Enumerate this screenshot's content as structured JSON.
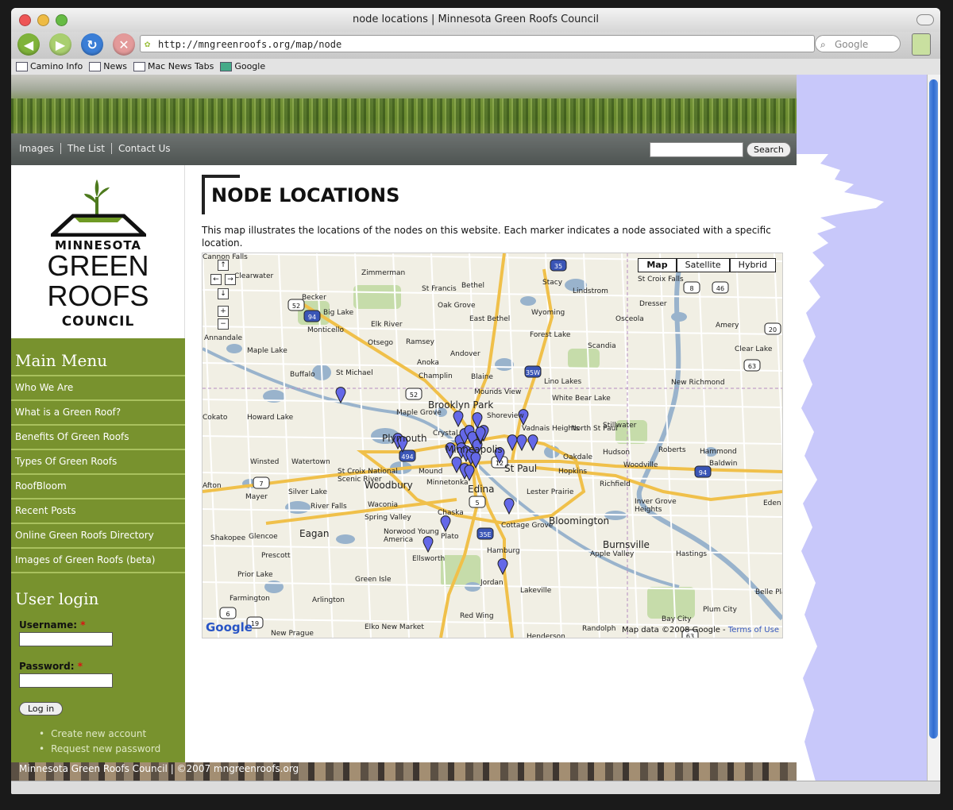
{
  "window": {
    "title": "node locations | Minnesota Green Roofs Council",
    "url": "http://mngreenroofs.org/map/node",
    "search_placeholder": "Google"
  },
  "bookmarks": [
    "Camino Info",
    "News",
    "Mac News Tabs",
    "Google"
  ],
  "site_nav": {
    "links": [
      "Images",
      "The List",
      "Contact Us"
    ],
    "search_button": "Search"
  },
  "logo": {
    "line1": "MINNESOTA",
    "line2": "GREEN",
    "line3": "ROOFS",
    "line4": "COUNCIL"
  },
  "main_menu": {
    "title": "Main Menu",
    "items": [
      "Who We Are",
      "What is a Green Roof?",
      "Benefits Of Green Roofs",
      "Types Of Green Roofs",
      "RoofBloom",
      "Recent Posts",
      "Online Green Roofs Directory",
      "Images of Green Roofs (beta)"
    ]
  },
  "user_login": {
    "title": "User login",
    "username_label": "Username:",
    "password_label": "Password:",
    "required_mark": "*",
    "login_button": "Log in",
    "links": [
      "Create new account",
      "Request new password"
    ]
  },
  "page": {
    "title": "NODE LOCATIONS",
    "intro": "This map illustrates the locations of the nodes on this website. Each marker indicates a node associated with a specific location."
  },
  "map": {
    "types": [
      "Map",
      "Satellite",
      "Hybrid"
    ],
    "active_type": "Map",
    "logo": "Google",
    "copyright": "Map data ©2008 Google -",
    "terms": "Terms of Use",
    "places": [
      {
        "name": "Zimmerman",
        "size": "s"
      },
      {
        "name": "St Francis",
        "size": "s"
      },
      {
        "name": "Bethel",
        "size": "s"
      },
      {
        "name": "Stacy",
        "size": "s"
      },
      {
        "name": "Lindstrom",
        "size": "s"
      },
      {
        "name": "St Croix Falls",
        "size": "s"
      },
      {
        "name": "Becker",
        "size": "s"
      },
      {
        "name": "Big Lake",
        "size": "s"
      },
      {
        "name": "Oak Grove",
        "size": "s"
      },
      {
        "name": "Wyoming",
        "size": "s"
      },
      {
        "name": "Dresser",
        "size": "s"
      },
      {
        "name": "Clearwater",
        "size": "s"
      },
      {
        "name": "East Bethel",
        "size": "s"
      },
      {
        "name": "Osceola",
        "size": "s"
      },
      {
        "name": "Monticello",
        "size": "s"
      },
      {
        "name": "Elk River",
        "size": "s"
      },
      {
        "name": "Amery",
        "size": "s"
      },
      {
        "name": "Annandale",
        "size": "s"
      },
      {
        "name": "Otsego",
        "size": "s"
      },
      {
        "name": "Ramsey",
        "size": "s"
      },
      {
        "name": "Forest Lake",
        "size": "s"
      },
      {
        "name": "Maple Lake",
        "size": "s"
      },
      {
        "name": "Andover",
        "size": "s"
      },
      {
        "name": "Scandia",
        "size": "s"
      },
      {
        "name": "Clear Lake",
        "size": "s"
      },
      {
        "name": "Anoka",
        "size": "s"
      },
      {
        "name": "Buffalo",
        "size": "s"
      },
      {
        "name": "St Michael",
        "size": "s"
      },
      {
        "name": "Champlin",
        "size": "s"
      },
      {
        "name": "Blaine",
        "size": "s"
      },
      {
        "name": "Lino Lakes",
        "size": "s"
      },
      {
        "name": "New Richmond",
        "size": "s"
      },
      {
        "name": "White Bear Lake",
        "size": "s"
      },
      {
        "name": "Brooklyn Park",
        "size": "m"
      },
      {
        "name": "Mounds View",
        "size": "s"
      },
      {
        "name": "Maple Grove",
        "size": "s"
      },
      {
        "name": "Cokato",
        "size": "s"
      },
      {
        "name": "Howard Lake",
        "size": "s"
      },
      {
        "name": "Shoreview",
        "size": "s"
      },
      {
        "name": "Stillwater",
        "size": "s"
      },
      {
        "name": "Crystal",
        "size": "s"
      },
      {
        "name": "Vadnais Heights",
        "size": "s"
      },
      {
        "name": "North St Paul",
        "size": "s"
      },
      {
        "name": "Plymouth",
        "size": "m"
      },
      {
        "name": "Minneapolis",
        "size": "m"
      },
      {
        "name": "Roberts",
        "size": "s"
      },
      {
        "name": "Hammond",
        "size": "s"
      },
      {
        "name": "Hudson",
        "size": "s"
      },
      {
        "name": "Oakdale",
        "size": "s"
      },
      {
        "name": "Winsted",
        "size": "s"
      },
      {
        "name": "Watertown",
        "size": "s"
      },
      {
        "name": "St Paul",
        "size": "m"
      },
      {
        "name": "Baldwin",
        "size": "s"
      },
      {
        "name": "Woodville",
        "size": "s"
      },
      {
        "name": "St Croix National Scenic River",
        "size": "s"
      },
      {
        "name": "Mound",
        "size": "s"
      },
      {
        "name": "Hopkins",
        "size": "s"
      },
      {
        "name": "Woodbury",
        "size": "m"
      },
      {
        "name": "Minnetonka",
        "size": "s"
      },
      {
        "name": "Edina",
        "size": "m"
      },
      {
        "name": "Richfield",
        "size": "s"
      },
      {
        "name": "Afton",
        "size": "s"
      },
      {
        "name": "Silver Lake",
        "size": "s"
      },
      {
        "name": "Mayer",
        "size": "s"
      },
      {
        "name": "Lester Prairie",
        "size": "s"
      },
      {
        "name": "Inver Grove Heights",
        "size": "s"
      },
      {
        "name": "River Falls",
        "size": "s"
      },
      {
        "name": "Waconia",
        "size": "s"
      },
      {
        "name": "Eden Prairie",
        "size": "s"
      },
      {
        "name": "Spring Valley",
        "size": "s"
      },
      {
        "name": "Chaska",
        "size": "s"
      },
      {
        "name": "Bloomington",
        "size": "m"
      },
      {
        "name": "Cottage Grove",
        "size": "s"
      },
      {
        "name": "Eagan",
        "size": "m"
      },
      {
        "name": "Norwood Young America",
        "size": "s"
      },
      {
        "name": "Shakopee",
        "size": "s"
      },
      {
        "name": "Glencoe",
        "size": "s"
      },
      {
        "name": "Plato",
        "size": "s"
      },
      {
        "name": "Burnsville",
        "size": "m"
      },
      {
        "name": "Prescott",
        "size": "s"
      },
      {
        "name": "Hamburg",
        "size": "s"
      },
      {
        "name": "Apple Valley",
        "size": "s"
      },
      {
        "name": "Hastings",
        "size": "s"
      },
      {
        "name": "Ellsworth",
        "size": "s"
      },
      {
        "name": "Prior Lake",
        "size": "s"
      },
      {
        "name": "Green Isle",
        "size": "s"
      },
      {
        "name": "Jordan",
        "size": "s"
      },
      {
        "name": "Lakeville",
        "size": "s"
      },
      {
        "name": "Farmington",
        "size": "s"
      },
      {
        "name": "Arlington",
        "size": "s"
      },
      {
        "name": "Belle Plaine",
        "size": "s"
      },
      {
        "name": "Plum City",
        "size": "s"
      },
      {
        "name": "Bay City",
        "size": "s"
      },
      {
        "name": "Red Wing",
        "size": "s"
      },
      {
        "name": "Elko New Market",
        "size": "s"
      },
      {
        "name": "New Prague",
        "size": "s"
      },
      {
        "name": "Henderson",
        "size": "s"
      },
      {
        "name": "Randolph",
        "size": "s"
      },
      {
        "name": "Cannon Falls",
        "size": "s"
      }
    ],
    "shields": [
      "35",
      "8",
      "46",
      "52",
      "94",
      "35W",
      "52",
      "494",
      "12",
      "94",
      "5",
      "7",
      "35E",
      "63",
      "20",
      "19",
      "6",
      "63"
    ]
  },
  "footer": {
    "text": "Minnesota Green Roofs Council | ©2007 mngreenroofs.org"
  }
}
